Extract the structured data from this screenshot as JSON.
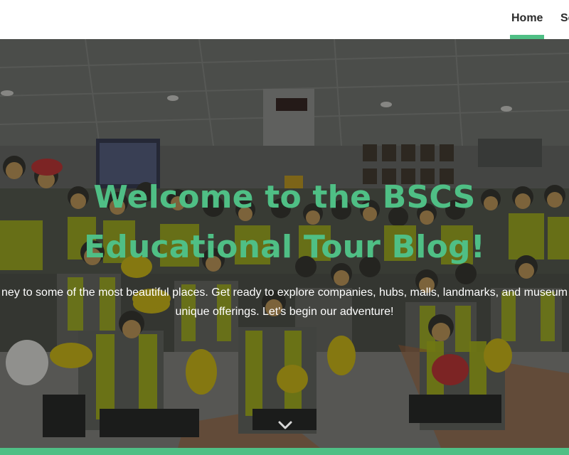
{
  "nav": {
    "items": [
      {
        "label": "Home",
        "active": true
      },
      {
        "label": "Se",
        "active": false
      }
    ],
    "accent_color": "#4fbf85"
  },
  "hero": {
    "title_line1": "Welcome to the BSCS",
    "title_line2": "Educational Tour Blog!",
    "subtitle_line1": "ney to some of the most beautiful places. Get ready to explore companies, hubs, malls, landmarks, and museum",
    "subtitle_line2": "unique offerings. Let's begin our adventure!",
    "title_color": "#4fbf85",
    "scroll_icon": "chevron-down-icon"
  }
}
